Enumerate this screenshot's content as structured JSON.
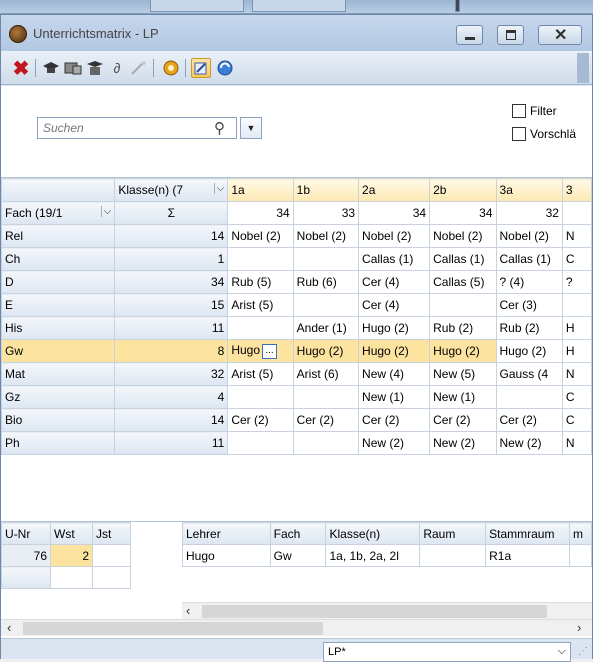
{
  "window": {
    "title": "Unterrichtsmatrix - LP",
    "close_glyph": "✕"
  },
  "toolbar": {
    "icons": [
      "delete-icon",
      "graduation-cap-icon",
      "class-icon",
      "teacher-icon",
      "link-icon",
      "wand-icon",
      "settings-icon",
      "edit-icon",
      "refresh-icon"
    ]
  },
  "search": {
    "placeholder": "Suchen",
    "value": ""
  },
  "filters": {
    "filter_label": "Filter",
    "vorschlag_label": "Vorschlä"
  },
  "grid": {
    "corner_top": "",
    "classes_header": "Klasse(n) (7",
    "fach_header": "Fach (19/1",
    "sigma": "Σ",
    "columns": [
      "1a",
      "1b",
      "2a",
      "2b",
      "3a",
      "3"
    ],
    "column_totals": [
      "34",
      "33",
      "34",
      "34",
      "32",
      ""
    ],
    "rows": [
      {
        "fach": "Rel",
        "sum": "14",
        "cells": [
          "Nobel (2)",
          "Nobel (2)",
          "Nobel (2)",
          "Nobel (2)",
          "Nobel (2)",
          "N"
        ]
      },
      {
        "fach": "Ch",
        "sum": "1",
        "cells": [
          "",
          "",
          "Callas (1)",
          "Callas (1)",
          "Callas (1)",
          "C"
        ]
      },
      {
        "fach": "D",
        "sum": "34",
        "cells": [
          "Rub (5)",
          "Rub (6)",
          "Cer (4)",
          "Callas (5)",
          "? (4)",
          "?"
        ]
      },
      {
        "fach": "E",
        "sum": "15",
        "cells": [
          "Arist (5)",
          "",
          "Cer (4)",
          "",
          "Cer (3)",
          ""
        ]
      },
      {
        "fach": "His",
        "sum": "11",
        "cells": [
          "",
          "Ander (1)",
          "Hugo (2)",
          "Rub (2)",
          "Rub (2)",
          "H"
        ]
      },
      {
        "fach": "Gw",
        "sum": "8",
        "cells": [
          "Hugo",
          "Hugo (2)",
          "Hugo (2)",
          "Hugo (2)",
          "Hugo (2)",
          "H"
        ]
      },
      {
        "fach": "Mat",
        "sum": "32",
        "cells": [
          "Arist (5)",
          "Arist (6)",
          "New (4)",
          "New (5)",
          "Gauss (4",
          "N"
        ]
      },
      {
        "fach": "Gz",
        "sum": "4",
        "cells": [
          "",
          "",
          "New (1)",
          "New (1)",
          "",
          "C"
        ]
      },
      {
        "fach": "Bio",
        "sum": "14",
        "cells": [
          "Cer (2)",
          "Cer (2)",
          "Cer (2)",
          "Cer (2)",
          "Cer (2)",
          "C"
        ]
      },
      {
        "fach": "Ph",
        "sum": "11",
        "cells": [
          "",
          "",
          "New (2)",
          "New (2)",
          "New (2)",
          "N"
        ]
      }
    ],
    "dots_label": "..."
  },
  "lesson_table": {
    "headers": [
      "U-Nr",
      "Wst",
      "Jst"
    ],
    "row": [
      "76",
      "2",
      ""
    ]
  },
  "detail_table": {
    "headers": [
      "Lehrer",
      "Fach",
      "Klasse(n)",
      "Raum",
      "Stammraum",
      "m"
    ],
    "row": [
      "Hugo",
      "Gw",
      "1a, 1b, 2a, 2l",
      "",
      "R1a",
      ""
    ]
  },
  "statusbar": {
    "view_select": "LP*"
  },
  "colors": {
    "highlight": "#fce4a0",
    "header_bg": "#dce6f2"
  }
}
